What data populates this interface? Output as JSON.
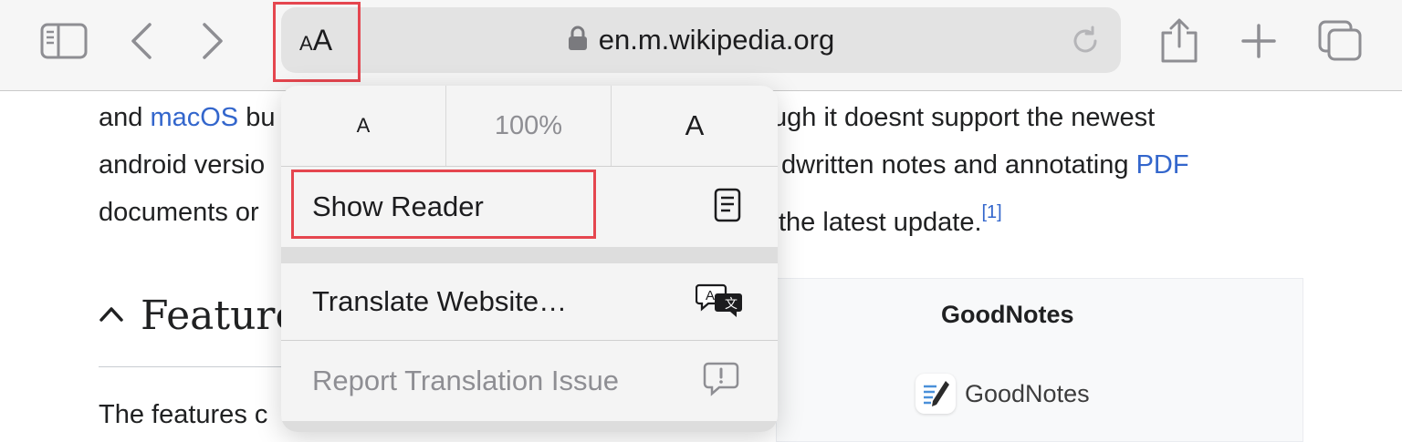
{
  "toolbar": {
    "sidebar_icon": "sidebar-icon",
    "back_icon": "chevron-left-icon",
    "forward_icon": "chevron-right-icon",
    "share_icon": "share-icon",
    "new_tab_icon": "plus-icon",
    "tabs_icon": "tabs-overview-icon"
  },
  "address_bar": {
    "aa_small": "A",
    "aa_big": "A",
    "lock_icon": "lock-icon",
    "url": "en.m.wikipedia.org",
    "reload_icon": "reload-icon"
  },
  "article": {
    "line1": {
      "a": "and ",
      "link": "macOS",
      "b": " bu",
      "c": "ugh it doesnt support the newest"
    },
    "line2": {
      "a": "android versio",
      "b": "dwritten notes and annotating ",
      "link": "PDF"
    },
    "line3": {
      "a": "documents or",
      "b": " the latest update.",
      "ref": "[1]"
    },
    "heading": "Feature",
    "line4": "The features c"
  },
  "infobox": {
    "title": "GoodNotes",
    "logo_text": "GoodNotes"
  },
  "menu": {
    "zoom": {
      "decrease": "A",
      "percent": "100%",
      "increase": "A"
    },
    "show_reader": {
      "label": "Show Reader",
      "icon": "reader-icon"
    },
    "translate": {
      "label": "Translate Website…",
      "icon": "translate-icon"
    },
    "report": {
      "label": "Report Translation Issue",
      "icon": "report-icon"
    }
  },
  "colors": {
    "highlight": "#e5464f",
    "link": "#3366cc",
    "disabled": "#8e8e93"
  }
}
